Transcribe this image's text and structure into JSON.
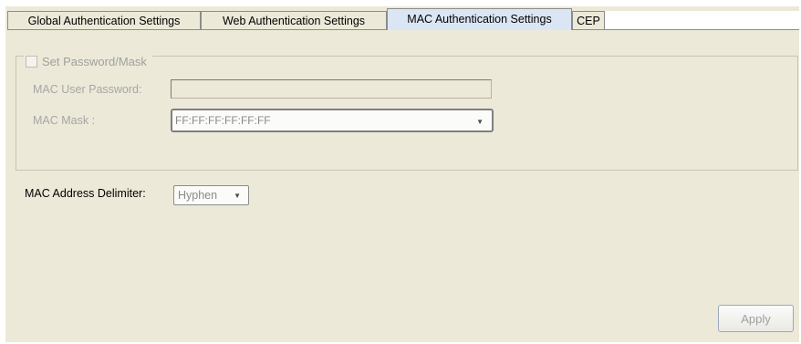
{
  "tabs": [
    {
      "label": "Global Authentication Settings",
      "active": false
    },
    {
      "label": "Web Authentication Settings",
      "active": false
    },
    {
      "label": "MAC Authentication Settings",
      "active": true
    },
    {
      "label": "CEP",
      "active": false
    }
  ],
  "password_group": {
    "checkbox_label": "Set Password/Mask",
    "checked": false,
    "enabled": false,
    "mac_user_password_label": "MAC User Password:",
    "mac_user_password_value": "",
    "mac_mask_label": "MAC Mask :",
    "mac_mask_value": "FF:FF:FF:FF:FF:FF"
  },
  "delimiter": {
    "label": "MAC Address Delimiter:",
    "value": "Hyphen"
  },
  "apply_label": "Apply",
  "icons": {
    "dropdown": "chevron-down-icon"
  },
  "colors": {
    "panel_background": "#ece9d8",
    "active_tab": "#dbe6f4",
    "disabled_text": "#a6a6a6"
  }
}
